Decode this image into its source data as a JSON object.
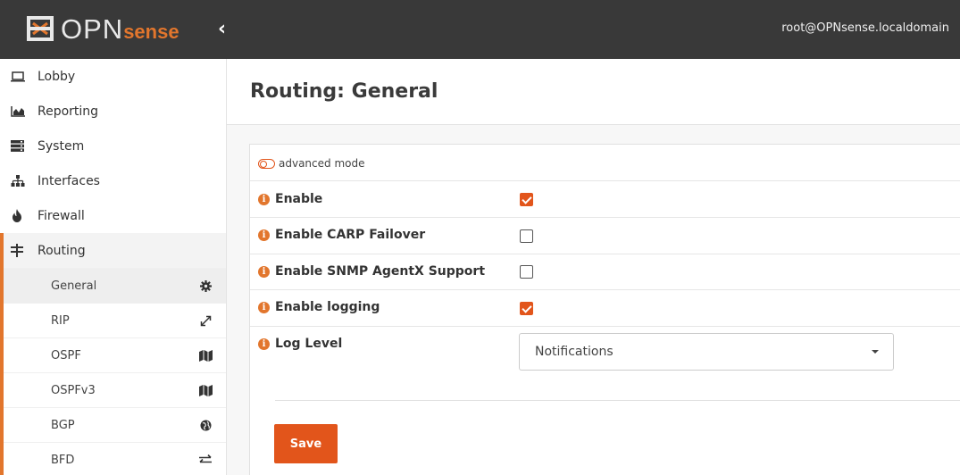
{
  "topbar": {
    "logo_text": "OPN",
    "logo_text_sense": "sense",
    "collapse_icon": "chevron-left-icon",
    "collapse_glyph": "‹",
    "user": "root@OPNsense.localdomain"
  },
  "sidebar": {
    "items": [
      {
        "label": "Lobby",
        "icon": "laptop-icon"
      },
      {
        "label": "Reporting",
        "icon": "area-chart-icon"
      },
      {
        "label": "System",
        "icon": "server-icon"
      },
      {
        "label": "Interfaces",
        "icon": "sitemap-icon"
      },
      {
        "label": "Firewall",
        "icon": "fire-icon"
      },
      {
        "label": "Routing",
        "icon": "signpost-icon"
      }
    ],
    "routing_sub": [
      {
        "label": "General",
        "icon": "gear-icon"
      },
      {
        "label": "RIP",
        "icon": "expand-arrows-icon"
      },
      {
        "label": "OSPF",
        "icon": "map-icon"
      },
      {
        "label": "OSPFv3",
        "icon": "map-icon"
      },
      {
        "label": "BGP",
        "icon": "globe-icon"
      },
      {
        "label": "BFD",
        "icon": "exchange-icon"
      }
    ]
  },
  "main": {
    "title": "Routing: General",
    "advanced_mode_label": "advanced mode",
    "fields": {
      "enable": {
        "label": "Enable",
        "checked": true
      },
      "carp": {
        "label": "Enable CARP Failover",
        "checked": false
      },
      "snmp": {
        "label": "Enable SNMP AgentX Support",
        "checked": false
      },
      "logging": {
        "label": "Enable logging",
        "checked": true
      },
      "log_level": {
        "label": "Log Level",
        "value": "Notifications"
      }
    },
    "info_glyph": "i",
    "save_label": "Save"
  },
  "colors": {
    "accent": "#e2762d",
    "button": "#e2551b",
    "topbar": "#393939"
  }
}
